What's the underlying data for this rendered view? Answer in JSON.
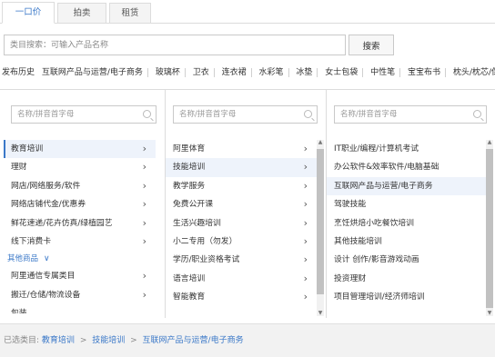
{
  "tabs": [
    {
      "label": "一口价",
      "active": true
    },
    {
      "label": "拍卖",
      "active": false
    },
    {
      "label": "租赁",
      "active": false
    }
  ],
  "search": {
    "placeholder": "类目搜索：可输入产品名称",
    "button_label": "搜索"
  },
  "recent": {
    "label": "发布历史",
    "items": [
      "互联网产品与运营/电子商务",
      "玻璃杯",
      "卫衣",
      "连衣裙",
      "水彩笔",
      "冰垫",
      "女士包袋",
      "中性笔",
      "宝宝布书",
      "枕头/枕芯/保健"
    ]
  },
  "columns": [
    {
      "search_placeholder": "名称/拼音首字母",
      "items": [
        {
          "label": "教育培训",
          "selected": true
        },
        {
          "label": "理财",
          "selected": false
        },
        {
          "label": "网店/网络服务/软件",
          "selected": false
        },
        {
          "label": "网络店铺代金/优惠券",
          "selected": false
        },
        {
          "label": "鲜花速递/花卉仿真/绿植园艺",
          "selected": false
        },
        {
          "label": "线下消费卡",
          "selected": false
        }
      ],
      "group_label": "其他商品",
      "group_items": [
        {
          "label": "阿里通信专属类目",
          "selected": false
        },
        {
          "label": "搬迁/仓储/物流设备",
          "selected": false
        },
        {
          "label": "包装",
          "selected": false
        }
      ]
    },
    {
      "search_placeholder": "名称/拼音首字母",
      "items": [
        {
          "label": "阿里体育",
          "selected": false
        },
        {
          "label": "技能培训",
          "selected": true
        },
        {
          "label": "教学服务",
          "selected": false
        },
        {
          "label": "免费公开课",
          "selected": false
        },
        {
          "label": "生活兴趣培训",
          "selected": false
        },
        {
          "label": "小二专用（勿发）",
          "selected": false
        },
        {
          "label": "学历/职业资格考试",
          "selected": false
        },
        {
          "label": "语言培训",
          "selected": false
        },
        {
          "label": "智能教育",
          "selected": false
        }
      ]
    },
    {
      "search_placeholder": "名称/拼音首字母",
      "items": [
        {
          "label": "IT职业/编程/计算机考试",
          "selected": false
        },
        {
          "label": "办公软件&效率软件/电脑基础",
          "selected": false
        },
        {
          "label": "互联网产品与运营/电子商务",
          "selected": true
        },
        {
          "label": "驾驶技能",
          "selected": false
        },
        {
          "label": "烹饪烘焙小吃餐饮培训",
          "selected": false
        },
        {
          "label": "其他技能培训",
          "selected": false
        },
        {
          "label": "设计 创作/影音游戏动画",
          "selected": false
        },
        {
          "label": "投资理财",
          "selected": false
        },
        {
          "label": "项目管理培训/经济师培训",
          "selected": false
        }
      ]
    }
  ],
  "footer": {
    "label": "已选类目:",
    "path": [
      "教育培训",
      "技能培训",
      "互联网产品与运营/电子商务"
    ],
    "separator": ">"
  },
  "colors": {
    "accent": "#3a78c8",
    "selected_bg": "#eef3fb",
    "footer_bg": "#f2f2f2"
  }
}
